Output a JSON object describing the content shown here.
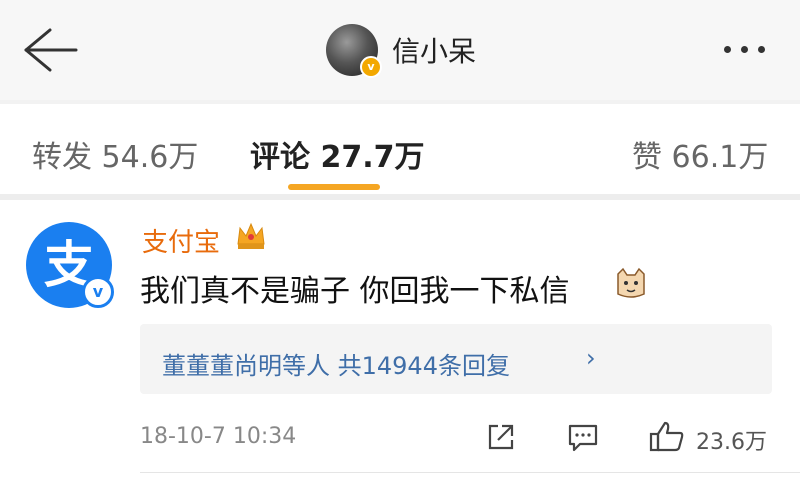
{
  "header": {
    "username": "信小呆",
    "avatar_badge": "v"
  },
  "tabs": {
    "repost": "转发 54.6万",
    "comment": "评论 27.7万",
    "like": "赞 66.1万",
    "active": "comment",
    "accent_color": "#f5a623"
  },
  "comment": {
    "author": "支付宝",
    "author_color": "#e86b0c",
    "author_avatar_glyph": "支",
    "verified_glyph": "v",
    "text": "我们真不是骗子 你回我一下私信",
    "reply_summary": "董董董尚明等人  共14944条回复",
    "reply_chevron": "›",
    "timestamp": "18-10-7 10:34",
    "like_count": "23.6万",
    "icons": [
      "back-arrow-icon",
      "more-dots-icon",
      "crown-icon",
      "cat-emoji-icon",
      "share-icon",
      "comment-icon",
      "thumbs-up-icon"
    ]
  }
}
